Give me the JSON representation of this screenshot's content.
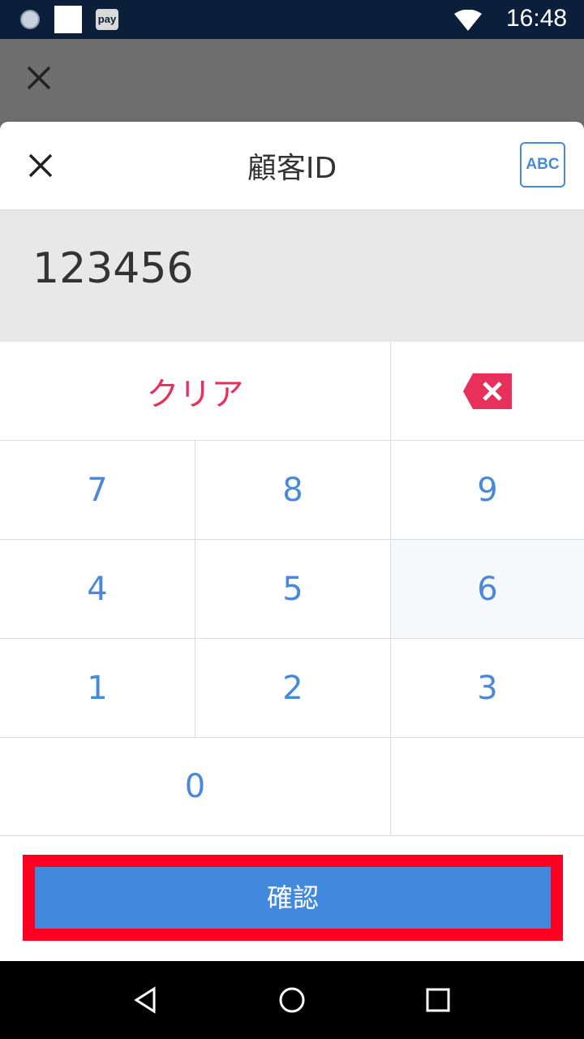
{
  "status_bar": {
    "time": "16:48",
    "pay_label": "pay",
    "icons": [
      "clock-icon",
      "notification-square-icon",
      "pay-icon",
      "wifi-icon"
    ]
  },
  "backdrop": {
    "close_icon": "close-icon"
  },
  "dialog": {
    "title": "顧客ID",
    "abc_label": "ABC",
    "input_value": "123456"
  },
  "keypad": {
    "clear_label": "クリア",
    "backspace_icon": "backspace-icon",
    "keys": {
      "k7": "7",
      "k8": "8",
      "k9": "9",
      "k4": "4",
      "k5": "5",
      "k6": "6",
      "k1": "1",
      "k2": "2",
      "k3": "3",
      "k0": "0"
    },
    "key_color": "#4a88da",
    "clear_color": "#e8315a"
  },
  "confirm": {
    "label": "確認",
    "color": "#4288dd",
    "highlight_color": "#ff0022"
  },
  "nav_bar": {
    "icons": [
      "back-icon",
      "home-icon",
      "recents-icon"
    ]
  }
}
